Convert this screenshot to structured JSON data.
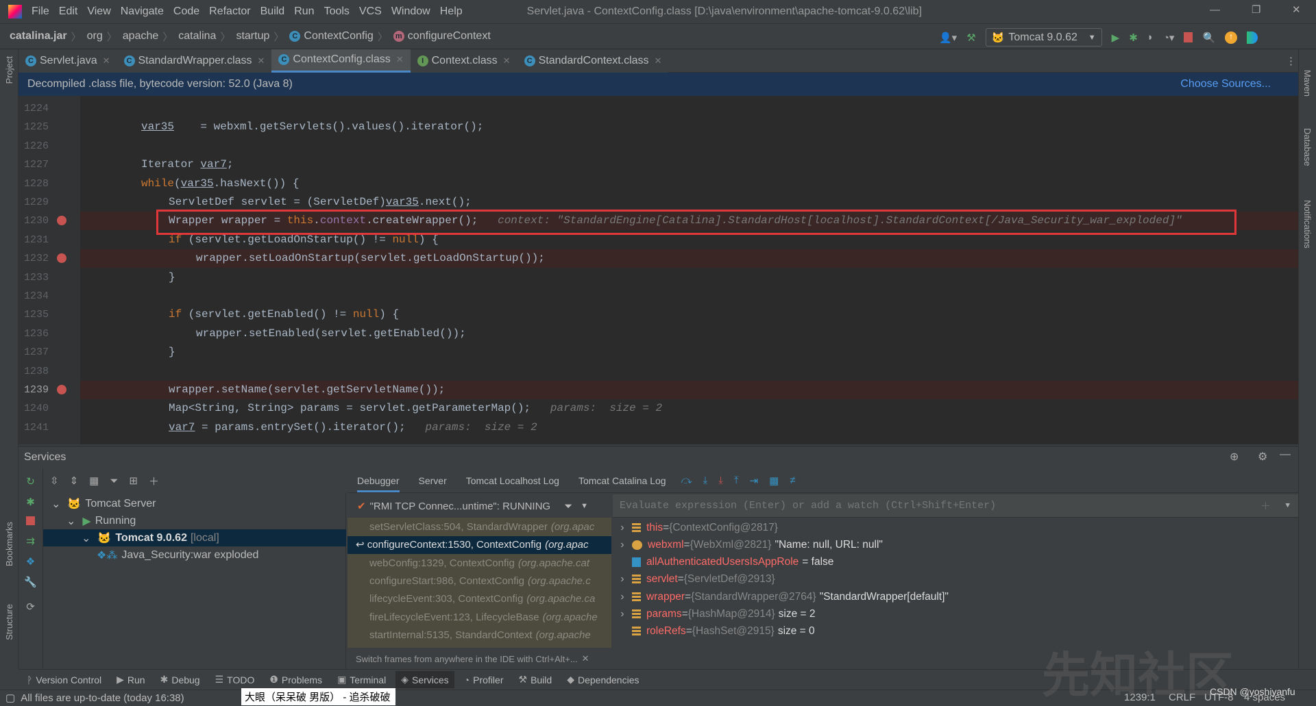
{
  "window": {
    "title": "Servlet.java - ContextConfig.class [D:\\java\\environment\\apache-tomcat-9.0.62\\lib]"
  },
  "menu": [
    "File",
    "Edit",
    "View",
    "Navigate",
    "Code",
    "Refactor",
    "Build",
    "Run",
    "Tools",
    "VCS",
    "Window",
    "Help"
  ],
  "breadcrumb": [
    "catalina.jar",
    "org",
    "apache",
    "catalina",
    "startup",
    "ContextConfig",
    "configureContext"
  ],
  "run_config": "Tomcat 9.0.62",
  "tabs": [
    {
      "label": "Servlet.java",
      "icon": "C"
    },
    {
      "label": "StandardWrapper.class",
      "icon": "C"
    },
    {
      "label": "ContextConfig.class",
      "icon": "C",
      "active": true
    },
    {
      "label": "Context.class",
      "icon": "I"
    },
    {
      "label": "StandardContext.class",
      "icon": "C"
    }
  ],
  "banner": {
    "text": "Decompiled .class file, bytecode version: 52.0 (Java 8)",
    "action": "Choose Sources..."
  },
  "code": [
    {
      "n": "1224",
      "t": []
    },
    {
      "n": "1225",
      "t": [
        [
          "ul",
          "var35"
        ],
        [
          "",
          "    = webxml.getServlets().values().iterator();"
        ]
      ],
      "i": 1
    },
    {
      "n": "1226",
      "t": []
    },
    {
      "n": "1227",
      "t": [
        [
          "",
          "Iterator "
        ],
        [
          "ul",
          "var7"
        ],
        [
          "",
          ";"
        ]
      ],
      "i": 1
    },
    {
      "n": "1228",
      "t": [
        [
          "kw",
          "while"
        ],
        [
          "",
          "("
        ],
        [
          "ul",
          "var35"
        ],
        [
          "",
          ".hasNext()) {"
        ]
      ],
      "i": 1
    },
    {
      "n": "1229",
      "t": [
        [
          "",
          "ServletDef servlet = (ServletDef)"
        ],
        [
          "ul",
          "var35"
        ],
        [
          "",
          ".next();"
        ]
      ],
      "i": 2
    },
    {
      "n": "1230",
      "t": [
        [
          "",
          "Wrapper wrapper = "
        ],
        [
          "kw",
          "this"
        ],
        [
          "",
          "."
        ],
        [
          "fld",
          "context"
        ],
        [
          "",
          ".createWrapper();"
        ],
        [
          "hint",
          "   context: \"StandardEngine[Catalina].StandardHost[localhost].StandardContext[/Java_Security_war_exploded]\""
        ]
      ],
      "i": 2,
      "bp": true
    },
    {
      "n": "1231",
      "t": [
        [
          "kw",
          "if"
        ],
        [
          "",
          " (servlet.getLoadOnStartup() != "
        ],
        [
          "kw",
          "null"
        ],
        [
          "",
          ") {"
        ]
      ],
      "i": 2
    },
    {
      "n": "1232",
      "t": [
        [
          "",
          "wrapper.setLoadOnStartup(servlet.getLoadOnStartup());"
        ]
      ],
      "i": 3,
      "bp": true
    },
    {
      "n": "1233",
      "t": [
        [
          "",
          "}"
        ]
      ],
      "i": 2
    },
    {
      "n": "1234",
      "t": []
    },
    {
      "n": "1235",
      "t": [
        [
          "kw",
          "if"
        ],
        [
          "",
          " (servlet.getEnabled() != "
        ],
        [
          "kw",
          "null"
        ],
        [
          "",
          ") {"
        ]
      ],
      "i": 2
    },
    {
      "n": "1236",
      "t": [
        [
          "",
          "wrapper.setEnabled(servlet.getEnabled());"
        ]
      ],
      "i": 3
    },
    {
      "n": "1237",
      "t": [
        [
          "",
          "}"
        ]
      ],
      "i": 2
    },
    {
      "n": "1238",
      "t": []
    },
    {
      "n": "1239",
      "t": [
        [
          "",
          "wrapper.setName(servlet.getServletName());"
        ]
      ],
      "i": 2,
      "bp": true
    },
    {
      "n": "1240",
      "t": [
        [
          "",
          "Map<String, String> params = servlet.getParameterMap();"
        ],
        [
          "hint",
          "   params:  size = 2"
        ]
      ],
      "i": 2
    },
    {
      "n": "1241",
      "t": [
        [
          "ul",
          "var7"
        ],
        [
          "",
          " = params.entrySet().iterator();"
        ],
        [
          "hint",
          "   params:  size = 2"
        ]
      ],
      "i": 2
    }
  ],
  "services": {
    "title": "Services",
    "tree": [
      {
        "label": "Tomcat Server",
        "level": 0
      },
      {
        "label": "Running",
        "level": 1
      },
      {
        "label": "Tomcat 9.0.62",
        "suffix": "[local]",
        "level": 2,
        "selected": true
      },
      {
        "label": "Java_Security:war exploded",
        "level": 3
      }
    ]
  },
  "debugger": {
    "tabs": [
      "Debugger",
      "Server",
      "Tomcat Localhost Log",
      "Tomcat Catalina Log"
    ],
    "thread": "\"RMI TCP Connec...untime\": RUNNING",
    "frames": [
      {
        "m": "setServletClass:504, StandardWrapper",
        "p": "(org.apac"
      },
      {
        "m": "configureContext:1530, ContextConfig",
        "p": "(org.apac",
        "current": true
      },
      {
        "m": "webConfig:1329, ContextConfig",
        "p": "(org.apache.cat"
      },
      {
        "m": "configureStart:986, ContextConfig",
        "p": "(org.apache.c"
      },
      {
        "m": "lifecycleEvent:303, ContextConfig",
        "p": "(org.apache.ca"
      },
      {
        "m": "fireLifecycleEvent:123, LifecycleBase",
        "p": "(org.apache"
      },
      {
        "m": "startInternal:5135, StandardContext",
        "p": "(org.apache"
      }
    ],
    "switch_hint": "Switch frames from anywhere in the IDE with Ctrl+Alt+...",
    "eval_placeholder": "Evaluate expression (Enter) or add a watch (Ctrl+Shift+Enter)",
    "vars": [
      {
        "name": "this",
        "type": "{ContextConfig@2817}",
        "val": "",
        "exp": true,
        "icon": "field"
      },
      {
        "name": "webxml",
        "type": "{WebXml@2821}",
        "val": "\"Name: null, URL: null\"",
        "exp": true,
        "icon": "param"
      },
      {
        "name": "allAuthenticatedUsersIsAppRole",
        "type": "",
        "val": "= false",
        "exp": false,
        "icon": "boolean"
      },
      {
        "name": "servlet",
        "type": "{ServletDef@2913}",
        "val": "",
        "exp": true,
        "icon": "field"
      },
      {
        "name": "wrapper",
        "type": "{StandardWrapper@2764}",
        "val": "\"StandardWrapper[default]\"",
        "exp": true,
        "icon": "field"
      },
      {
        "name": "params",
        "type": "{HashMap@2914}",
        "val": "size = 2",
        "exp": true,
        "icon": "field"
      },
      {
        "name": "roleRefs",
        "type": "{HashSet@2915}",
        "val": "size = 0",
        "exp": false,
        "icon": "field"
      }
    ]
  },
  "bottom_tabs": [
    "Version Control",
    "Run",
    "Debug",
    "TODO",
    "Problems",
    "Terminal",
    "Services",
    "Profiler",
    "Build",
    "Dependencies"
  ],
  "status": {
    "message": "All files are up-to-date (today 16:38)",
    "ime": "大眼（呆呆破 男版） - 追杀破破",
    "position": "1239:1",
    "line_sep": "CRLF",
    "encoding": "UTF-8",
    "indent": "4 spaces",
    "watermark": "CSDN @yoshiyanfu"
  },
  "side": {
    "left": [
      "Project",
      "Bookmarks",
      "Structure"
    ],
    "right": [
      "Maven",
      "Database",
      "Notifications"
    ]
  },
  "colors": {
    "accent": "#4a88c7",
    "breakpoint": "#c75450",
    "highlight_box": "#e0373b"
  }
}
